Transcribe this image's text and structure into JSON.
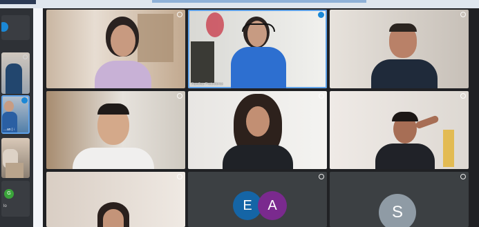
{
  "meeting": {
    "participants": [
      {
        "name": "",
        "tile": "woman-glasses-lavender"
      },
      {
        "name": "Familias Protectoras",
        "tile": "woman-headset-blue-vest"
      },
      {
        "name": "",
        "tile": "man-glasses-dark-jacket"
      },
      {
        "name": "",
        "tile": "man-white-shirt"
      },
      {
        "name": "",
        "tile": "woman-curly-hair"
      },
      {
        "name": "",
        "tile": "woman-hand-on-head"
      },
      {
        "name": "",
        "tile": "woman-bottom-left"
      },
      {
        "name": "",
        "tile": "avatars-ea"
      },
      {
        "name": "",
        "tile": "avatar-s"
      }
    ],
    "avatars": [
      {
        "initial": "E",
        "color": "#1565a6"
      },
      {
        "initial": "A",
        "color": "#7a2a8e"
      },
      {
        "initial": "S",
        "color": "#8f9ba5"
      }
    ]
  },
  "rail": {
    "badge_label": "G",
    "tile_caption": "…an | ⁝",
    "bottom_caption": "lo"
  }
}
